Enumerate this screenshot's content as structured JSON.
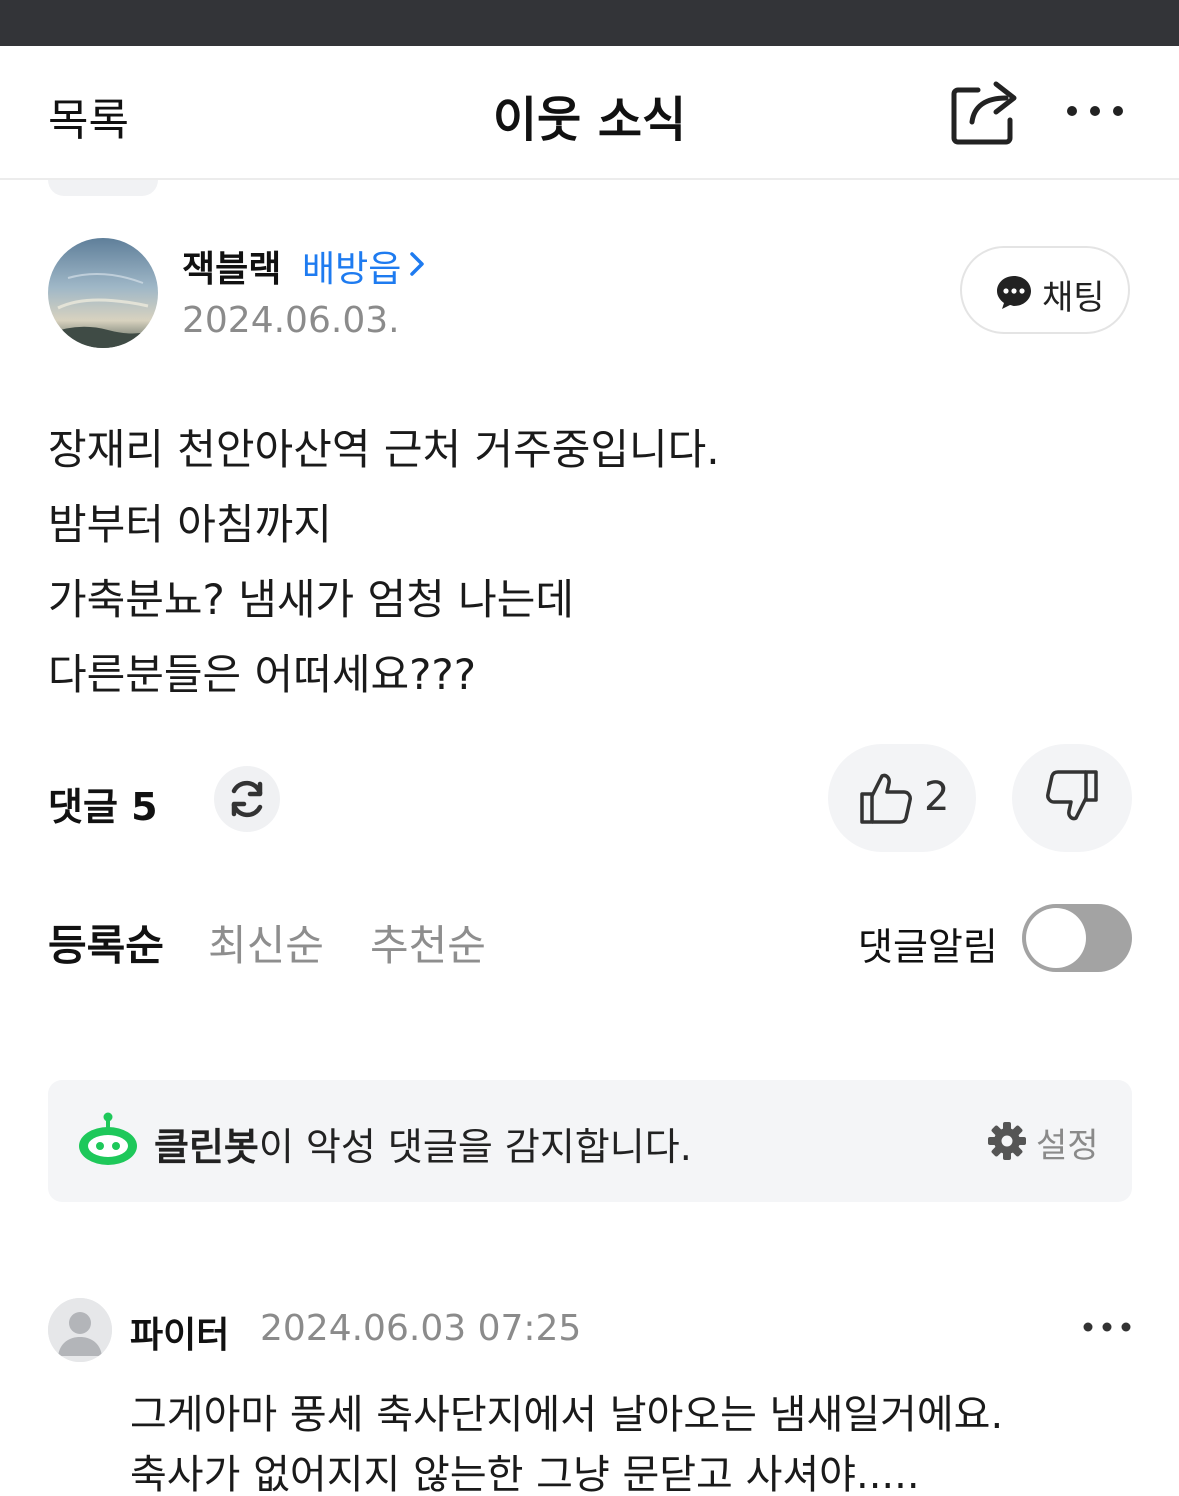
{
  "header": {
    "back_label": "목록",
    "title": "이웃 소식"
  },
  "post": {
    "author": {
      "name": "잭블랙",
      "location": "배방읍",
      "date": "2024.06.03."
    },
    "chat_label": "채팅",
    "body_lines": [
      "장재리 천안아산역 근처 거주중입니다.",
      "밤부터 아침까지",
      "가축분뇨? 냄새가 엄청 나는데",
      "다른분들은 어떠세요???"
    ],
    "like_count": "2"
  },
  "comments_section": {
    "label": "댓글 5",
    "sort_tabs": [
      "등록순",
      "최신순",
      "추천순"
    ],
    "active_sort": "등록순",
    "notify_label": "댓글알림",
    "notify_on": false
  },
  "cleanbot": {
    "name": "클린봇",
    "message": "이 악성 댓글을 감지합니다.",
    "settings_label": "설정"
  },
  "comments": [
    {
      "author": "파이터",
      "timestamp": "2024.06.03 07:25",
      "lines": [
        "그게아마 풍세 축사단지에서 날아오는 냄새일거에요.",
        "축사가 없어지지 않는한 그냥 문닫고 사셔야....."
      ]
    }
  ],
  "colors": {
    "accent_blue": "#1e7bf0",
    "cleanbot_green": "#1ec85a",
    "toggle_off": "#a3a3a3"
  },
  "icons": {
    "share": "share-icon",
    "more": "more-dots-icon",
    "chat": "chat-bubble-icon",
    "refresh": "refresh-icon",
    "like": "thumbs-up-icon",
    "dislike": "thumbs-down-icon",
    "cleanbot": "robot-icon",
    "settings": "gear-icon"
  }
}
